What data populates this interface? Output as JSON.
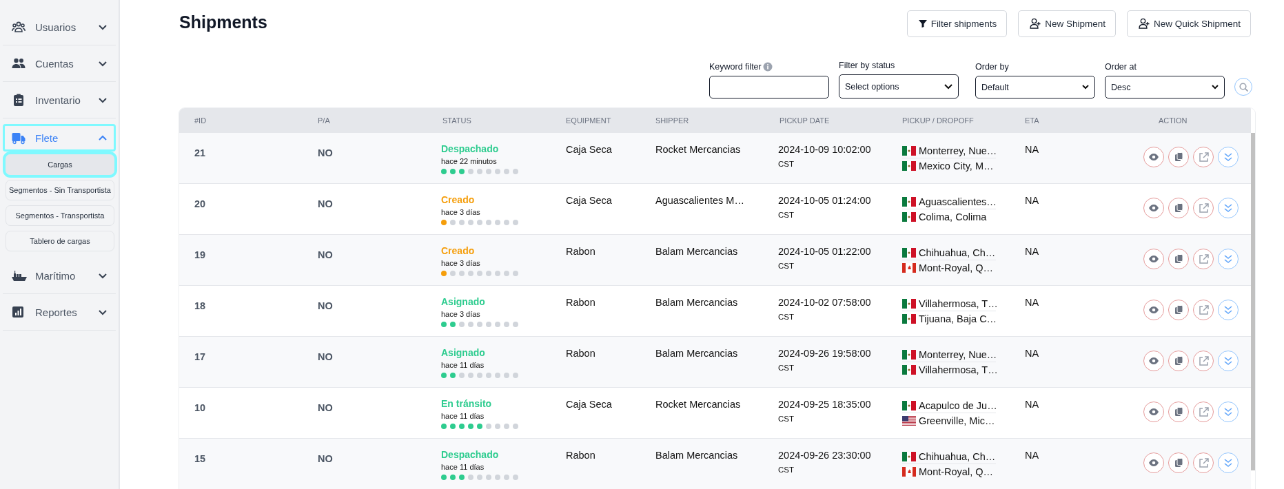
{
  "sidebar": {
    "items": [
      {
        "label": "Usuarios",
        "kind": "users",
        "expanded": false,
        "selected": false
      },
      {
        "label": "Cuentas",
        "kind": "people",
        "expanded": false,
        "selected": false
      },
      {
        "label": "Inventario",
        "kind": "clipboard",
        "expanded": false,
        "selected": false
      },
      {
        "label": "Flete",
        "kind": "truck",
        "expanded": true,
        "selected": true,
        "children": [
          {
            "label": "Cargas",
            "selected": true
          },
          {
            "label": "Segmentos - Sin Transportista",
            "selected": false
          },
          {
            "label": "Segmentos - Transportista",
            "selected": false
          },
          {
            "label": "Tablero de cargas",
            "selected": false
          }
        ]
      },
      {
        "label": "Marítimo",
        "kind": "ship",
        "expanded": false,
        "selected": false
      },
      {
        "label": "Reportes",
        "kind": "chart",
        "expanded": false,
        "selected": false
      }
    ]
  },
  "page": {
    "title": "Shipments"
  },
  "actions": [
    {
      "label": "Filter shipments",
      "kind": "filter"
    },
    {
      "label": "New Shipment",
      "kind": "add-user"
    },
    {
      "label": "New Quick Shipment",
      "kind": "add-user"
    }
  ],
  "filters": [
    {
      "label": "Keyword filter",
      "kind": "text",
      "info": true
    },
    {
      "label": "Filter by status",
      "kind": "multiselect",
      "value": "Select options",
      "info": false
    },
    {
      "label": "Order by",
      "kind": "select",
      "value": "Default",
      "info": false
    },
    {
      "label": "Order at",
      "kind": "select",
      "value": "Desc",
      "info": false
    }
  ],
  "table": {
    "columns": [
      "#ID",
      "P/A",
      "STATUS",
      "EQUIPMENT",
      "SHIPPER",
      "PICKUP DATE",
      "PICKUP / DROPOFF",
      "ETA",
      "ACTION"
    ],
    "rows": [
      {
        "id": "21",
        "pa": "NO",
        "status": {
          "text": "Despachado",
          "color": "#2ecc8f",
          "time": "hace 22 minutos",
          "steps": [
            {
              "done": true
            },
            {
              "done": true
            },
            {
              "done": true
            },
            {
              "done": false
            },
            {
              "done": false
            },
            {
              "done": false
            },
            {
              "done": false
            },
            {
              "done": false
            },
            {
              "done": false
            }
          ]
        },
        "equipment": "Caja Seca",
        "shipper": "Rocket Mercancias",
        "pickup_date": "2024-10-09 10:02:00",
        "timezone": "CST",
        "stops": [
          {
            "kind": "mexico",
            "text": "Monterrey, Nue…"
          },
          {
            "kind": "mexico",
            "text": "Mexico City, M…"
          }
        ],
        "eta": "NA"
      },
      {
        "id": "20",
        "pa": "NO",
        "status": {
          "text": "Creado",
          "color": "#f59e0b",
          "time": "hace 3 días",
          "steps": [
            {
              "done": true
            },
            {
              "done": false
            },
            {
              "done": false
            },
            {
              "done": false
            },
            {
              "done": false
            },
            {
              "done": false
            },
            {
              "done": false
            },
            {
              "done": false
            },
            {
              "done": false
            }
          ]
        },
        "equipment": "Caja Seca",
        "shipper": "Aguascalientes M…",
        "pickup_date": "2024-10-05 01:24:00",
        "timezone": "CST",
        "stops": [
          {
            "kind": "mexico",
            "text": "Aguascalientes…"
          },
          {
            "kind": "mexico",
            "text": "Colima, Colima"
          }
        ],
        "eta": "NA"
      },
      {
        "id": "19",
        "pa": "NO",
        "status": {
          "text": "Creado",
          "color": "#f59e0b",
          "time": "hace 3 días",
          "steps": [
            {
              "done": true
            },
            {
              "done": false
            },
            {
              "done": false
            },
            {
              "done": false
            },
            {
              "done": false
            },
            {
              "done": false
            },
            {
              "done": false
            },
            {
              "done": false
            },
            {
              "done": false
            }
          ]
        },
        "equipment": "Rabon",
        "shipper": "Balam Mercancias",
        "pickup_date": "2024-10-05 01:22:00",
        "timezone": "CST",
        "stops": [
          {
            "kind": "mexico",
            "text": "Chihuahua, Ch…"
          },
          {
            "kind": "canada",
            "text": "Mont-Royal, Q…"
          }
        ],
        "eta": "NA"
      },
      {
        "id": "18",
        "pa": "NO",
        "status": {
          "text": "Asignado",
          "color": "#2ecc8f",
          "time": "hace 3 días",
          "steps": [
            {
              "done": true
            },
            {
              "done": true
            },
            {
              "done": false
            },
            {
              "done": false
            },
            {
              "done": false
            },
            {
              "done": false
            },
            {
              "done": false
            },
            {
              "done": false
            },
            {
              "done": false
            }
          ]
        },
        "equipment": "Rabon",
        "shipper": "Balam Mercancias",
        "pickup_date": "2024-10-02 07:58:00",
        "timezone": "CST",
        "stops": [
          {
            "kind": "mexico",
            "text": "Villahermosa, T…"
          },
          {
            "kind": "mexico",
            "text": "Tijuana, Baja C…"
          }
        ],
        "eta": "NA"
      },
      {
        "id": "17",
        "pa": "NO",
        "status": {
          "text": "Asignado",
          "color": "#2ecc8f",
          "time": "hace 11 días",
          "steps": [
            {
              "done": true
            },
            {
              "done": true
            },
            {
              "done": false
            },
            {
              "done": false
            },
            {
              "done": false
            },
            {
              "done": false
            },
            {
              "done": false
            },
            {
              "done": false
            },
            {
              "done": false
            }
          ]
        },
        "equipment": "Rabon",
        "shipper": "Balam Mercancias",
        "pickup_date": "2024-09-26 19:58:00",
        "timezone": "CST",
        "stops": [
          {
            "kind": "mexico",
            "text": "Monterrey, Nue…"
          },
          {
            "kind": "mexico",
            "text": "Villahermosa, T…"
          }
        ],
        "eta": "NA"
      },
      {
        "id": "10",
        "pa": "NO",
        "status": {
          "text": "En tránsito",
          "color": "#2ecc8f",
          "time": "hace 11 días",
          "steps": [
            {
              "done": true
            },
            {
              "done": true
            },
            {
              "done": true
            },
            {
              "done": true
            },
            {
              "done": true
            },
            {
              "done": false
            },
            {
              "done": false
            },
            {
              "done": false
            },
            {
              "done": false
            }
          ]
        },
        "equipment": "Caja Seca",
        "shipper": "Rocket Mercancias",
        "pickup_date": "2024-09-25 18:35:00",
        "timezone": "CST",
        "stops": [
          {
            "kind": "mexico",
            "text": "Acapulco de Ju…"
          },
          {
            "kind": "usa",
            "text": "Greenville, Mic…"
          }
        ],
        "eta": "NA"
      },
      {
        "id": "15",
        "pa": "NO",
        "status": {
          "text": "Despachado",
          "color": "#2ecc8f",
          "time": "hace 11 días",
          "steps": [
            {
              "done": true
            },
            {
              "done": true
            },
            {
              "done": true
            },
            {
              "done": false
            },
            {
              "done": false
            },
            {
              "done": false
            },
            {
              "done": false
            },
            {
              "done": false
            },
            {
              "done": false
            }
          ]
        },
        "equipment": "Rabon",
        "shipper": "Balam Mercancias",
        "pickup_date": "2024-09-26 23:30:00",
        "timezone": "CST",
        "stops": [
          {
            "kind": "mexico",
            "text": "Chihuahua, Ch…"
          },
          {
            "kind": "canada",
            "text": "Mont-Royal, Q…"
          }
        ],
        "eta": "NA"
      }
    ]
  }
}
